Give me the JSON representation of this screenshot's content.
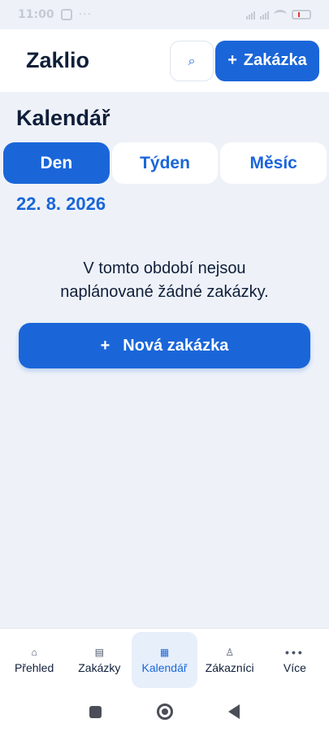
{
  "status_bar": {
    "time": "11:00"
  },
  "header": {
    "app_title": "Zaklio",
    "search_icon": "search-icon",
    "add_button_plus": "+",
    "add_button_label": "Zakázka"
  },
  "page": {
    "title": "Kalendář",
    "tabs": [
      {
        "label": "Den",
        "active": true
      },
      {
        "label": "Týden",
        "active": false
      },
      {
        "label": "Měsíc",
        "active": false
      }
    ],
    "date": "22. 8. 2026",
    "empty_message_line1": "V tomto období nejsou",
    "empty_message_line2": "naplánované žádné zakázky.",
    "new_job_plus": "+",
    "new_job_label": "Nová zakázka"
  },
  "bottom_nav": {
    "items": [
      {
        "label": "Přehled",
        "icon": "home-icon",
        "active": false
      },
      {
        "label": "Zakázky",
        "icon": "list-icon",
        "active": false
      },
      {
        "label": "Kalendář",
        "icon": "calendar-icon",
        "active": true
      },
      {
        "label": "Zákazníci",
        "icon": "customer-icon",
        "active": false
      },
      {
        "label": "Více",
        "icon": "more-icon",
        "active": false
      }
    ]
  },
  "colors": {
    "accent": "#1a66d9",
    "background": "#eef2f8",
    "text": "#0f1e3a"
  }
}
